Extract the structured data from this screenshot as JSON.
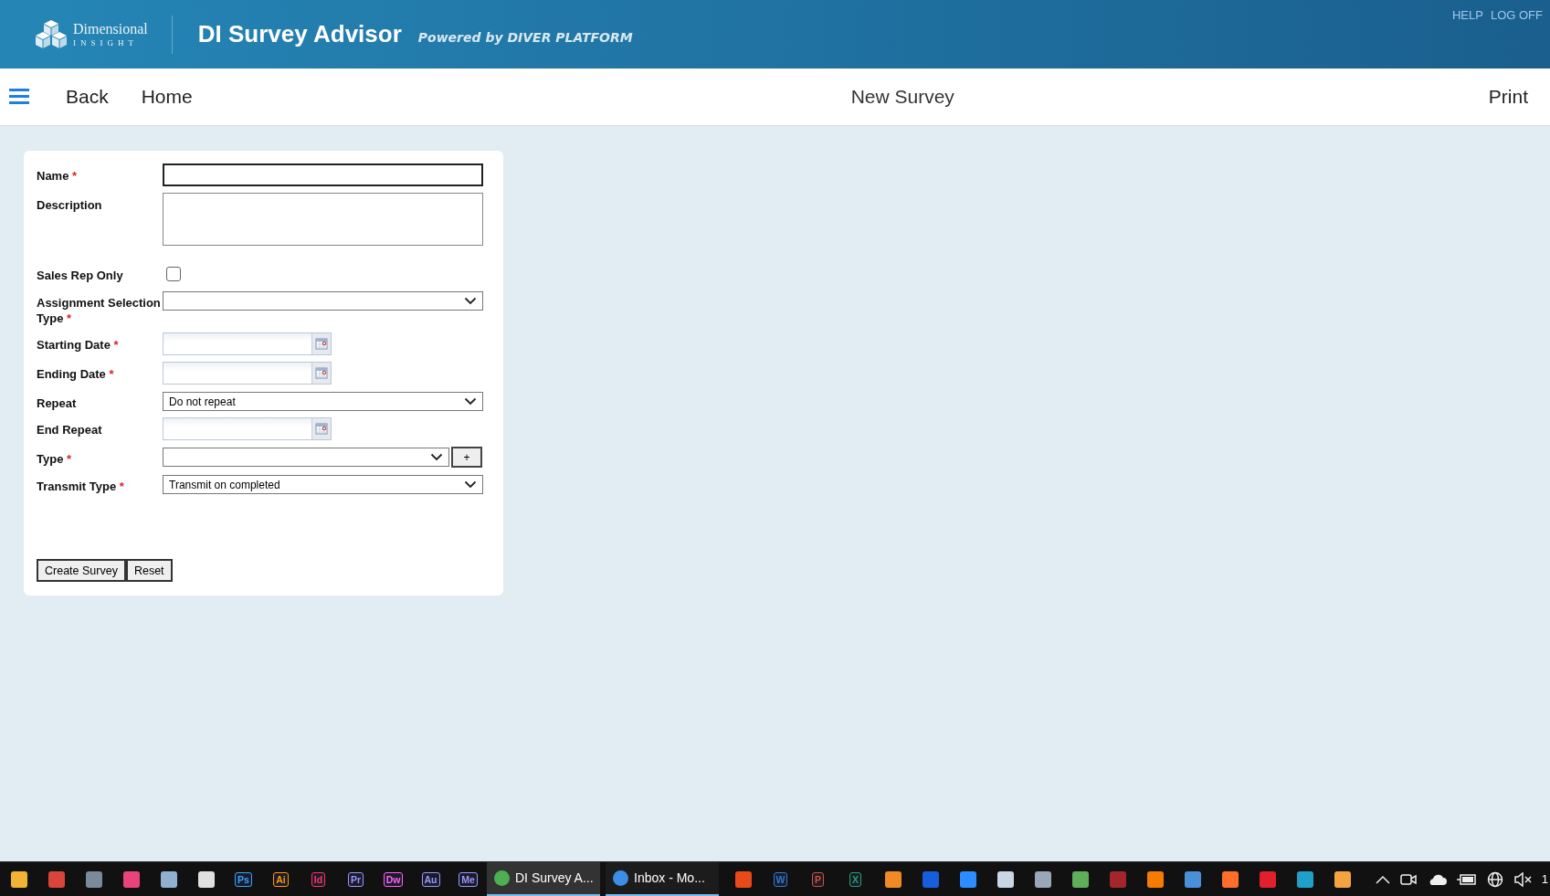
{
  "header": {
    "logo_line1": "Dimensional",
    "logo_line2": "INSIGHT",
    "title": "DI Survey Advisor",
    "subtitle": "Powered by DIVER PLATFORM",
    "links": [
      "HELP",
      "LOG OFF"
    ]
  },
  "nav": {
    "left": [
      "Back",
      "Home"
    ],
    "title": "New Survey",
    "right": "Print"
  },
  "form": {
    "fields": [
      {
        "kind": "text",
        "label": "Name",
        "required_mark": "*"
      },
      {
        "kind": "textarea",
        "label": "Description"
      },
      {
        "kind": "checkbox",
        "label": "Sales Rep Only",
        "checked": false
      },
      {
        "kind": "select",
        "label": "Assignment Selection Type",
        "required_mark": "*"
      },
      {
        "kind": "date",
        "label": "Starting Date",
        "required_mark": "*"
      },
      {
        "kind": "date",
        "label": "Ending Date",
        "required_mark": "*"
      },
      {
        "kind": "select",
        "label": "Repeat",
        "value": "Do not repeat"
      },
      {
        "kind": "date",
        "label": "End Repeat"
      },
      {
        "kind": "select-add",
        "label": "Type",
        "required_mark": "*",
        "add": "+"
      },
      {
        "kind": "select",
        "label": "Transmit Type",
        "required_mark": "*",
        "value": "Transmit on completed"
      }
    ],
    "buttons": [
      "Create Survey",
      "Reset"
    ]
  },
  "taskbar": {
    "items": [
      {
        "kind": "tile",
        "color": "#f2b233"
      },
      {
        "kind": "tile",
        "color": "#d9453b"
      },
      {
        "kind": "tile",
        "color": "#7a8a99"
      },
      {
        "kind": "tile",
        "color": "#e8447a"
      },
      {
        "kind": "tile",
        "color": "#8fb0cf"
      },
      {
        "kind": "tile",
        "color": "#e0e0e0"
      },
      {
        "kind": "glyph",
        "glyph": "Ps",
        "color": "#31a8ff"
      },
      {
        "kind": "glyph",
        "glyph": "Ai",
        "color": "#ff9a00"
      },
      {
        "kind": "glyph",
        "glyph": "Id",
        "color": "#ff3366"
      },
      {
        "kind": "glyph",
        "glyph": "Pr",
        "color": "#9999ff"
      },
      {
        "kind": "glyph",
        "glyph": "Dw",
        "color": "#ff61f6"
      },
      {
        "kind": "glyph",
        "glyph": "Au",
        "color": "#9999ff"
      },
      {
        "kind": "glyph",
        "glyph": "Me",
        "color": "#9999ff"
      },
      {
        "kind": "window",
        "title": "DI Survey A...",
        "color": "#4caf50",
        "selected": true
      },
      {
        "kind": "window",
        "title": "Inbox - Mo...",
        "color": "#3a8ee6",
        "selected": false
      },
      {
        "kind": "tile",
        "color": "#e64a19"
      },
      {
        "kind": "glyph",
        "glyph": "W",
        "color": "#2b7cd3"
      },
      {
        "kind": "glyph",
        "glyph": "P",
        "color": "#d35230"
      },
      {
        "kind": "glyph",
        "glyph": "X",
        "color": "#21a366"
      },
      {
        "kind": "tile",
        "color": "#f08a24"
      },
      {
        "kind": "tile",
        "color": "#175ddc"
      },
      {
        "kind": "tile",
        "color": "#2d8cff"
      },
      {
        "kind": "tile",
        "color": "#c9d6e3"
      },
      {
        "kind": "tile",
        "color": "#9aa7b8"
      },
      {
        "kind": "tile",
        "color": "#5fae5a"
      },
      {
        "kind": "tile",
        "color": "#a3262a"
      },
      {
        "kind": "tile",
        "color": "#f57c00"
      },
      {
        "kind": "tile",
        "color": "#4a90d9"
      },
      {
        "kind": "tile",
        "color": "#ff6d2a"
      },
      {
        "kind": "tile",
        "color": "#e0202b"
      },
      {
        "kind": "tile",
        "color": "#1fa0c9"
      },
      {
        "kind": "tile",
        "color": "#f4a340"
      }
    ],
    "clock": "1"
  }
}
